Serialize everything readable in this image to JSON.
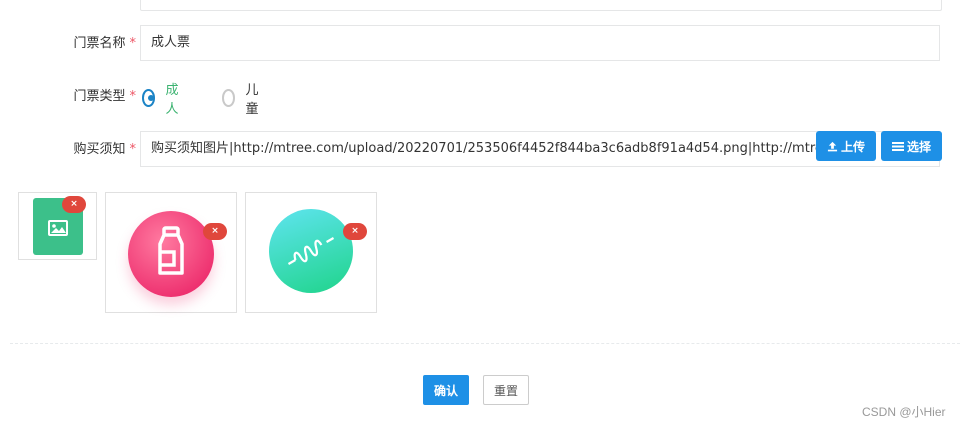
{
  "form": {
    "ticket_name": {
      "label": "门票名称",
      "required_mark": "*",
      "value": "成人票"
    },
    "ticket_type": {
      "label": "门票类型",
      "required_mark": "*",
      "options": [
        {
          "label": "成人",
          "checked": true
        },
        {
          "label": "儿童",
          "checked": false
        }
      ]
    },
    "purchase_notice": {
      "label": "购买须知",
      "required_mark": "*",
      "value": "购买须知图片|http://mtree.com/upload/20220701/253506f4452f844ba3c6adb8f91a4d54.png|http://mtree.com",
      "upload_label": "上传",
      "select_label": "选择",
      "images": [
        {
          "icon": "image-placeholder-icon",
          "color": "#3cc08a",
          "delete_label": "×"
        },
        {
          "icon": "bottle-icon",
          "color": "#f0457a",
          "delete_label": "×"
        },
        {
          "icon": "spring-icon",
          "color": "#35d9a6",
          "delete_label": "×"
        }
      ]
    }
  },
  "actions": {
    "confirm_label": "确认",
    "reset_label": "重置"
  },
  "watermark": "CSDN @小Hier",
  "colors": {
    "primary": "#1e90e6",
    "required": "#ed5565",
    "checked_label": "#3cb371",
    "delete": "#e0473c"
  }
}
